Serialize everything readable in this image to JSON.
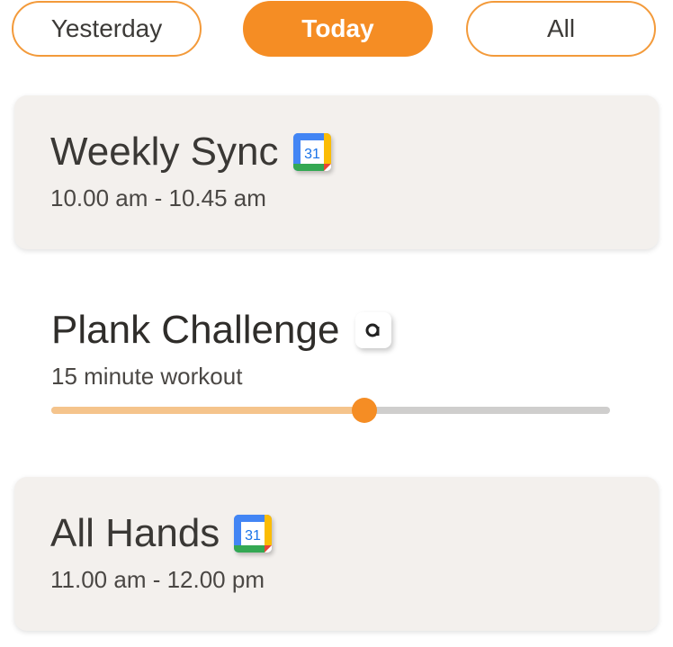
{
  "filters": {
    "yesterday": "Yesterday",
    "today": "Today",
    "all": "All",
    "selected": "Today"
  },
  "events": [
    {
      "title": "Weekly Sync",
      "time": "10.00 am - 10.45 am",
      "icon": "google-calendar-icon",
      "icon_text": "31"
    },
    {
      "title": "All Hands",
      "time": "11.00 am - 12.00 pm",
      "icon": "google-calendar-icon",
      "icon_text": "31"
    }
  ],
  "challenge": {
    "title": "Plank Challenge",
    "subtitle": "15 minute workout",
    "app_icon": "app-badge-icon",
    "progress": 0.56
  },
  "colors": {
    "accent": "#f58d24",
    "accent_light": "#f5c48c",
    "card_bg": "#f3f0ed",
    "track": "#cfcecd"
  }
}
